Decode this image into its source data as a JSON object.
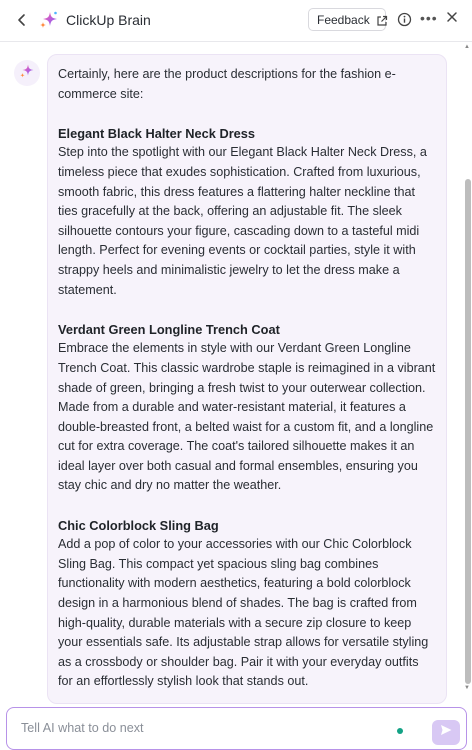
{
  "header": {
    "back_icon": "chevron-left-icon",
    "logo_icon": "sparkle-icon",
    "title": "ClickUp Brain",
    "feedback_label": "Feedback",
    "feedback_icon": "external-link-icon",
    "info_icon": "info-icon",
    "more_icon": "more-horizontal-icon",
    "close_icon": "close-icon"
  },
  "conversation": {
    "avatar_icon": "sparkle-icon",
    "intro": "Certainly, here are the product descriptions for the fashion e-commerce site:",
    "products": [
      {
        "name": "Elegant Black Halter Neck Dress",
        "description": "Step into the spotlight with our Elegant Black Halter Neck Dress, a timeless piece that exudes sophistication. Crafted from luxurious, smooth fabric, this dress features a flattering halter neckline that ties gracefully at the back, offering an adjustable fit. The sleek silhouette contours your figure, cascading down to a tasteful midi length. Perfect for evening events or cocktail parties, style it with strappy heels and minimalistic jewelry to let the dress make a statement."
      },
      {
        "name": "Verdant Green Longline Trench Coat",
        "description": "Embrace the elements in style with our Verdant Green Longline Trench Coat. This classic wardrobe staple is reimagined in a vibrant shade of green, bringing a fresh twist to your outerwear collection. Made from a durable and water-resistant material, it features a double-breasted front, a belted waist for a custom fit, and a longline cut for extra coverage. The coat's tailored silhouette makes it an ideal layer over both casual and formal ensembles, ensuring you stay chic and dry no matter the weather."
      },
      {
        "name": "Chic Colorblock Sling Bag",
        "description": "Add a pop of color to your accessories with our Chic Colorblock Sling Bag. This compact yet spacious sling bag combines functionality with modern aesthetics, featuring a bold colorblock design in a harmonious blend of shades. The bag is crafted from high-quality, durable materials with a secure zip closure to keep your essentials safe. Its adjustable strap allows for versatile styling as a crossbody or shoulder bag. Pair it with your everyday outfits for an effortlessly stylish look that stands out."
      }
    ]
  },
  "composer": {
    "placeholder": "Tell AI what to do next",
    "value": "",
    "send_icon": "send-icon"
  },
  "colors": {
    "accent": "#b792e8",
    "bubble_bg": "#f7f3fb",
    "send_bg": "#d8c8f4",
    "status_dot": "#13a285"
  }
}
